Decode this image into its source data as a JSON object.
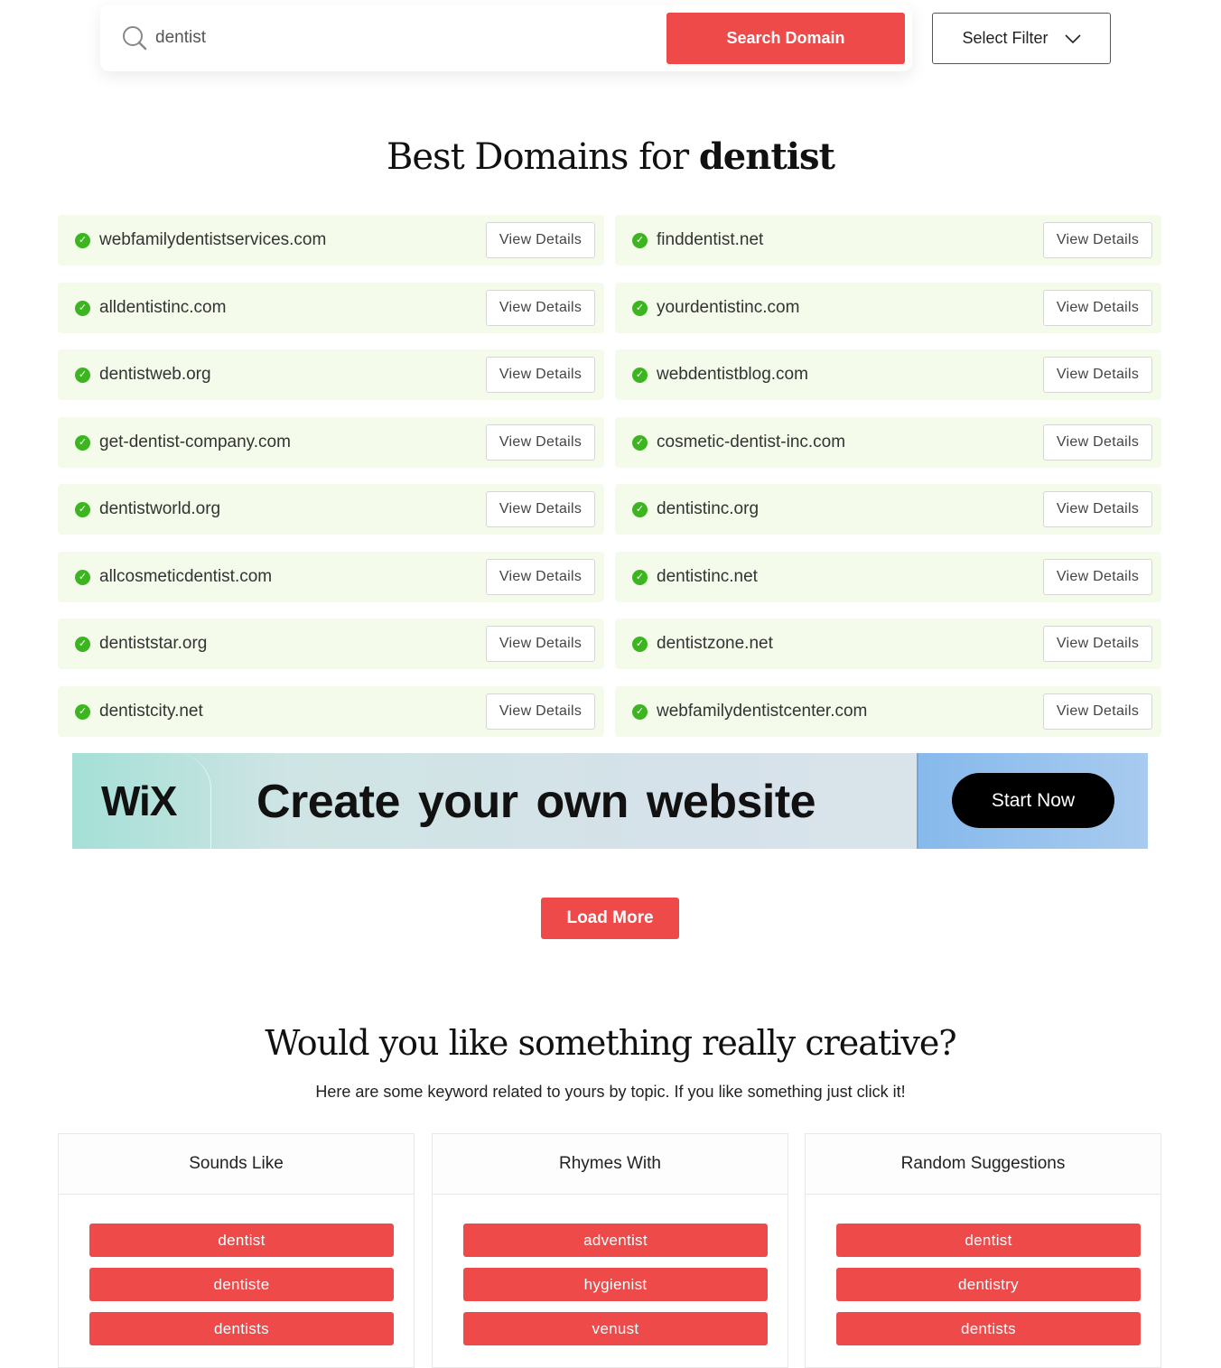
{
  "search": {
    "value": "dentist",
    "button": "Search Domain",
    "filter": "Select Filter"
  },
  "title": {
    "prefix": "Best Domains for",
    "keyword": "dentist"
  },
  "view_label": "View Details",
  "domains": [
    "webfamilydentistservices.com",
    "finddentist.net",
    "alldentistinc.com",
    "yourdentistinc.com",
    "dentistweb.org",
    "webdentistblog.com",
    "get-dentist-company.com",
    "cosmetic-dentist-inc.com",
    "dentistworld.org",
    "dentistinc.org",
    "allcosmeticdentist.com",
    "dentistinc.net",
    "dentiststar.org",
    "dentistzone.net",
    "dentistcity.net",
    "webfamilydentistcenter.com"
  ],
  "ad": {
    "logo": "WiX",
    "text": "Create your own  website",
    "cta": "Start Now"
  },
  "load_more": "Load More",
  "creative": {
    "title": "Would you like something really creative?",
    "subtitle": "Here are some keyword related to yours by topic. If you like something just click it!"
  },
  "cards": [
    {
      "title": "Sounds Like",
      "items": [
        "dentist",
        "dentiste",
        "dentists"
      ]
    },
    {
      "title": "Rhymes With",
      "items": [
        "adventist",
        "hygienist",
        "venust"
      ]
    },
    {
      "title": "Random Suggestions",
      "items": [
        "dentist",
        "dentistry",
        "dentists"
      ]
    }
  ],
  "colors": {
    "accent": "#ef4a4a",
    "row_bg": "#f4fbea",
    "check": "#3cb521"
  }
}
